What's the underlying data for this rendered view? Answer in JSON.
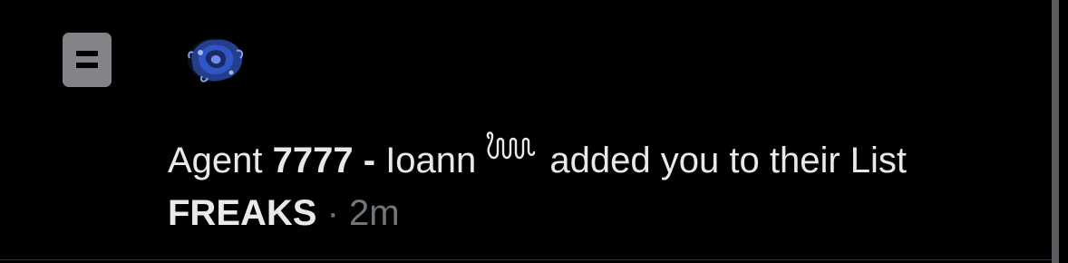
{
  "notification": {
    "icon": "list-icon",
    "avatar_icon": "blue-rose-avatar-icon",
    "actor_prefix": "Agent ",
    "actor_bold": "7777 -",
    "actor_suffix": " Ioann",
    "actor_emoji": "squiggle-glyph-icon",
    "action_text": " added you to their List",
    "list_name": "FREAKS",
    "separator": " · ",
    "timestamp": "2m"
  },
  "colors": {
    "background": "#000000",
    "text": "#e7e9ea",
    "muted": "#71767b",
    "icon_bg": "#828487"
  }
}
